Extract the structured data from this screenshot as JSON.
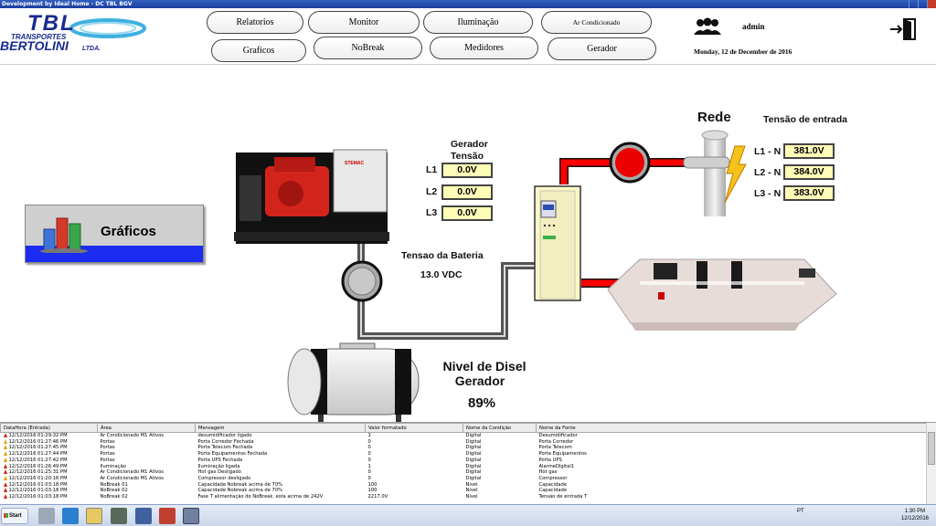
{
  "window": {
    "title": "Development by Ideal Home - DC TBL BGV"
  },
  "header": {
    "logo": {
      "mark": "TBL",
      "line1": "TRANSPORTES",
      "line2": "BERTOLINI",
      "suffix": "LTDA."
    },
    "nav": {
      "relatorios": "Relatorios",
      "monitor": "Monitor",
      "iluminacao": "Iluminação",
      "ar_condicionado": "Ar Condicionado",
      "graficos": "Graficos",
      "nobreak": "NoBreak",
      "medidores": "Medidores",
      "gerador": "Gerador"
    },
    "user": "admin",
    "date": "Monday, 12 de December de 2016",
    "icons": {
      "user": "users-icon",
      "exit": "exit-door-icon"
    }
  },
  "main": {
    "graficos_button": {
      "label": "Gráficos",
      "icon": "bar-chart-icon"
    },
    "gerador": {
      "title": "Gerador",
      "subtitle": "Tensão",
      "phases": [
        {
          "label": "L1",
          "value": "0.0V"
        },
        {
          "label": "L2",
          "value": "0.0V"
        },
        {
          "label": "L3",
          "value": "0.0V"
        }
      ]
    },
    "rede": {
      "title": "Rede",
      "entrada_title": "Tensão de entrada",
      "phases": [
        {
          "label": "L1 - N",
          "value": "381.0V"
        },
        {
          "label": "L2 - N",
          "value": "384.0V"
        },
        {
          "label": "L3 - N",
          "value": "383.0V"
        }
      ]
    },
    "bateria": {
      "label": "Tensao da Bateria",
      "value": "13.0 VDC"
    },
    "diesel": {
      "line1": "Nivel de Disel",
      "line2": "Gerador",
      "value": "89%",
      "level": 0.89
    },
    "generator_brand": "STEMAC",
    "colors": {
      "active_line": "#ff0000",
      "inactive_line": "#555555",
      "value_box": "#fffcb8"
    }
  },
  "alarms": {
    "columns": [
      "DataHora (Entrada)",
      "Área",
      "Mensagem",
      "Valor formatado",
      "Nome da Condição",
      "Nome da Fonte"
    ],
    "rows": [
      {
        "sev": "red",
        "c": [
          "12/12/2016 01:29:32 PM",
          "Ar Condicionado M1 Ativos",
          "desumidificador ligado",
          "1",
          "Digital",
          "Desumidificador"
        ]
      },
      {
        "sev": "yellow",
        "c": [
          "12/12/2016 01:27:46 PM",
          "Portas",
          "Porta Corredor Fechada",
          "0",
          "Digital",
          "Porta Corredor"
        ]
      },
      {
        "sev": "yellow",
        "c": [
          "12/12/2016 01:27:45 PM",
          "Portas",
          "Porta Telecom Fechada",
          "0",
          "Digital",
          "Porta Telecom"
        ]
      },
      {
        "sev": "yellow",
        "c": [
          "12/12/2016 01:27:44 PM",
          "Portas",
          "Porta Equipamentos Fechada",
          "0",
          "Digital",
          "Porta Equipamentos"
        ]
      },
      {
        "sev": "yellow",
        "c": [
          "12/12/2016 01:27:42 PM",
          "Portas",
          "Porta UPS Fechada",
          "0",
          "Digital",
          "Porta UPS"
        ]
      },
      {
        "sev": "red",
        "c": [
          "12/12/2016 01:26:49 PM",
          "Iluminação",
          "Iluminação ligada",
          "1",
          "Digital",
          "AlarmeDigital1"
        ]
      },
      {
        "sev": "red",
        "c": [
          "12/12/2016 01:25:31 PM",
          "Ar Condicionado M1 Ativos",
          "Hot gas Desligado",
          "0",
          "Digital",
          "Hot gas"
        ]
      },
      {
        "sev": "yellow",
        "c": [
          "12/12/2016 01:20:16 PM",
          "Ar Condicionado M1 Ativos",
          "Compressor desligado",
          "0",
          "Digital",
          "Compressor"
        ]
      },
      {
        "sev": "red",
        "c": [
          "12/12/2016 01:03:18 PM",
          "NoBreak 01",
          "Capacidade Nobreak acima de 70%",
          "100",
          "Nível",
          "Capacidade"
        ]
      },
      {
        "sev": "red",
        "c": [
          "12/12/2016 01:03:18 PM",
          "NoBreak 02",
          "Capacidade Nobreak acima de 70%",
          "100",
          "Nível",
          "Capacidade"
        ]
      },
      {
        "sev": "red",
        "c": [
          "12/12/2016 01:03:18 PM",
          "NoBreak 02",
          "Fase T alimentação do NoBreak. esta acima de 242V",
          "2217.0V",
          "Nível",
          "Tensão de entrada T"
        ]
      }
    ]
  },
  "taskbar": {
    "start": "Start",
    "lang": "PT",
    "time": "1:30 PM",
    "date": "12/12/2016"
  }
}
